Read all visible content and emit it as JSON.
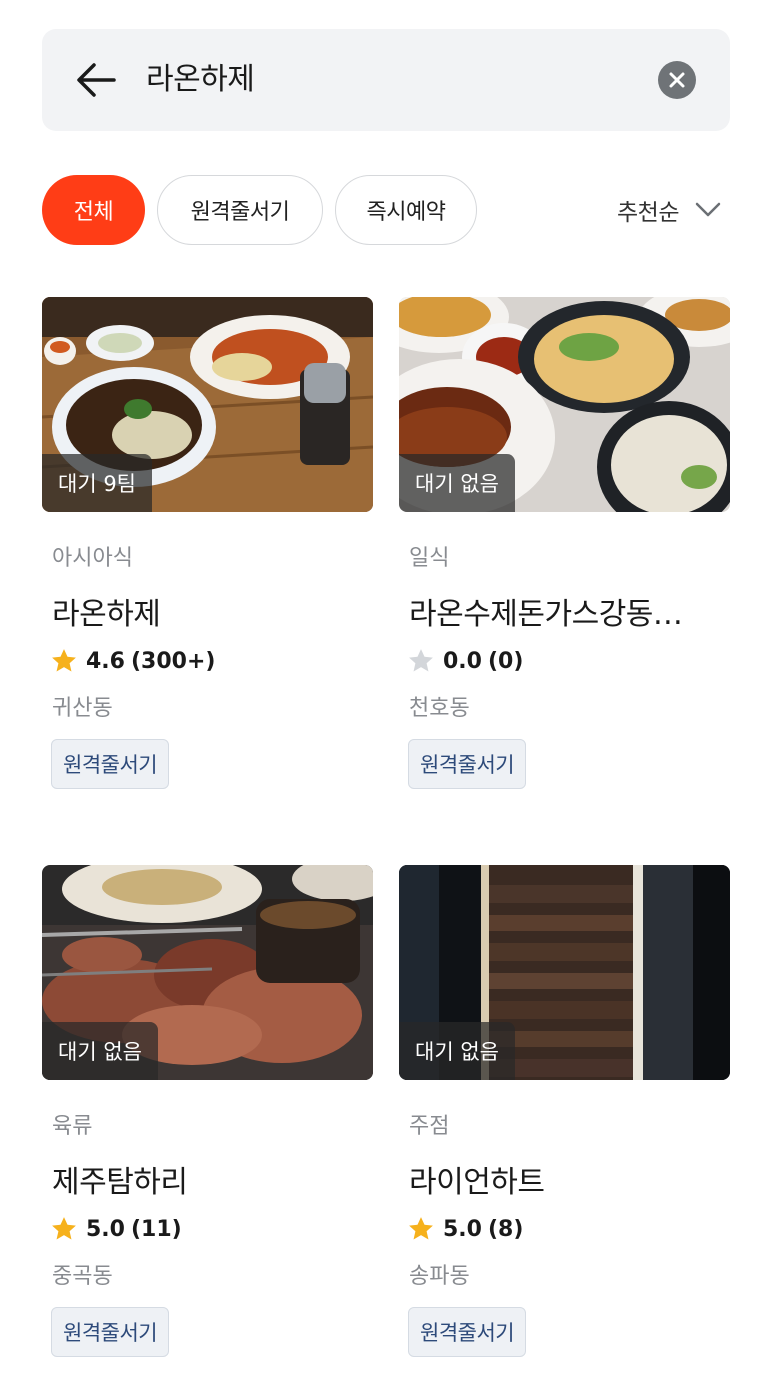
{
  "search": {
    "query": "라온하제"
  },
  "filters": {
    "chips": [
      {
        "label": "전체",
        "active": true
      },
      {
        "label": "원격줄서기",
        "active": false
      },
      {
        "label": "즉시예약",
        "active": false
      }
    ],
    "sort_label": "추천순"
  },
  "colors": {
    "accent": "#ff3d16",
    "star": "#f6b11c",
    "star_empty": "#d3d6da",
    "tag_text": "#2d4a7a"
  },
  "restaurants": [
    {
      "wait": "대기 9팀",
      "category": "아시아식",
      "name": "라온하제",
      "rating": "4.6",
      "reviews": "(300+)",
      "star": "filled",
      "location": "귀산동",
      "tag": "원격줄서기"
    },
    {
      "wait": "대기 없음",
      "category": "일식",
      "name": "라온수제돈가스강동…",
      "rating": "0.0",
      "reviews": "(0)",
      "star": "empty",
      "location": "천호동",
      "tag": "원격줄서기"
    },
    {
      "wait": "대기 없음",
      "category": "육류",
      "name": "제주탐하리",
      "rating": "5.0",
      "reviews": "(11)",
      "star": "filled",
      "location": "중곡동",
      "tag": "원격줄서기"
    },
    {
      "wait": "대기 없음",
      "category": "주점",
      "name": "라이언하트",
      "rating": "5.0",
      "reviews": "(8)",
      "star": "filled",
      "location": "송파동",
      "tag": "원격줄서기"
    }
  ]
}
